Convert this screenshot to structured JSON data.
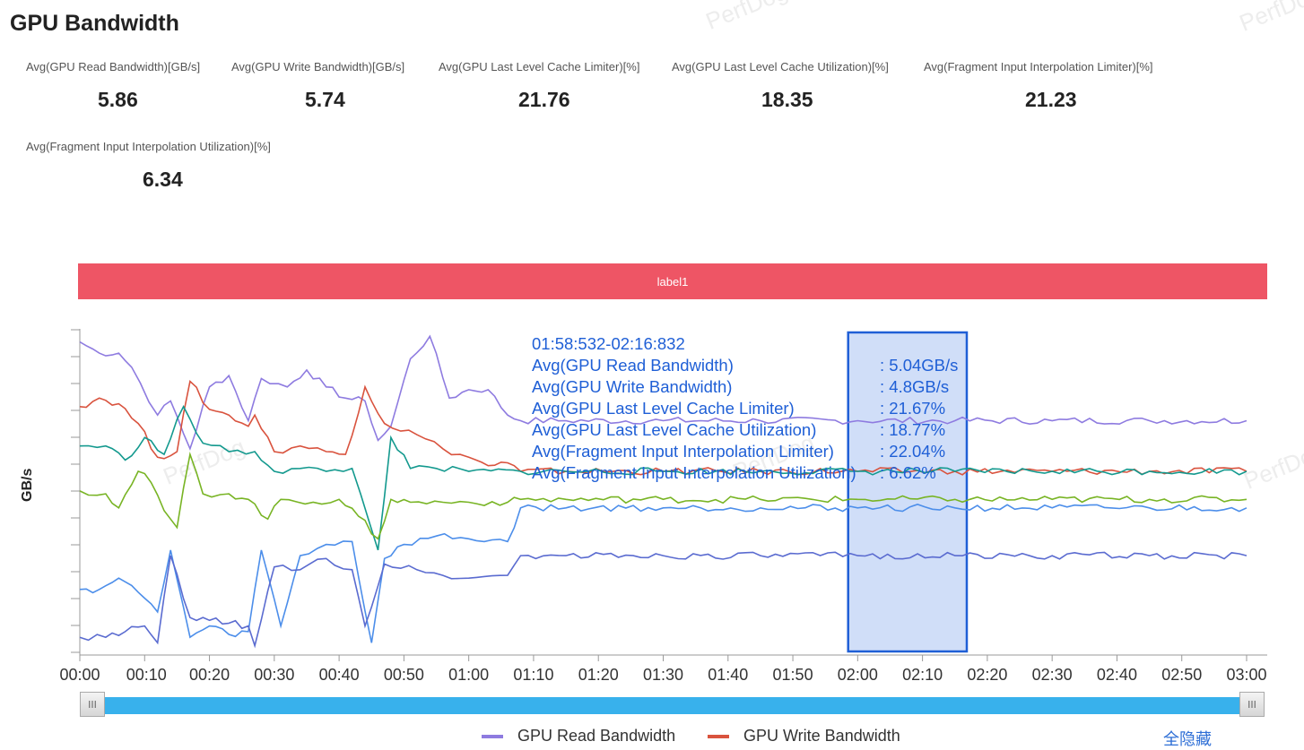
{
  "page": {
    "title": "GPU Bandwidth",
    "watermark": "PerfDog"
  },
  "stats": [
    {
      "label": "Avg(GPU Read Bandwidth)[GB/s]",
      "value": "5.86"
    },
    {
      "label": "Avg(GPU Write Bandwidth)[GB/s]",
      "value": "5.74"
    },
    {
      "label": "Avg(GPU Last Level Cache Limiter)[%]",
      "value": "21.76"
    },
    {
      "label": "Avg(GPU Last Level Cache Utilization)[%]",
      "value": "18.35"
    },
    {
      "label": "Avg(Fragment Input Interpolation Limiter)[%]",
      "value": "21.23"
    },
    {
      "label": "Avg(Fragment Input Interpolation Utilization)[%]",
      "value": "6.34"
    }
  ],
  "label_bar": {
    "text": "label1",
    "color": "#ee5565"
  },
  "tooltip": {
    "range": "01:58:532-02:16:832",
    "rows": [
      {
        "name": "Avg(GPU Read Bandwidth)",
        "value": ": 5.04GB/s"
      },
      {
        "name": "Avg(GPU Write Bandwidth)",
        "value": ": 4.8GB/s"
      },
      {
        "name": "Avg(GPU Last Level Cache Limiter)",
        "value": ": 21.67%"
      },
      {
        "name": "Avg(GPU Last Level Cache Utilization)",
        "value": ": 18.77%"
      },
      {
        "name": "Avg(Fragment Input Interpolation Limiter)",
        "value": ": 22.04%"
      },
      {
        "name": "Avg(Fragment Input Interpolation Utilization)",
        "value": ": 6.62%"
      }
    ]
  },
  "controls": {
    "hide_all": "全隐藏",
    "slider_handle_glyph": "III"
  },
  "chart_data": {
    "type": "line",
    "ylabel": "GB/s",
    "xlabel": "",
    "x_ticks": [
      "00:00",
      "00:10",
      "00:20",
      "00:30",
      "00:40",
      "00:50",
      "01:00",
      "01:10",
      "01:20",
      "01:30",
      "01:40",
      "01:50",
      "02:00",
      "02:10",
      "02:20",
      "02:30",
      "02:40",
      "02:50",
      "03:00"
    ],
    "x_range_seconds": [
      0,
      180
    ],
    "y_ticks_count": 12,
    "selection": {
      "start": "01:58:532",
      "end": "02:16:832"
    },
    "legend_visible": [
      "GPU Read Bandwidth",
      "GPU Write Bandwidth"
    ],
    "series": [
      {
        "name": "GPU Read Bandwidth",
        "color": "#8e7be0",
        "segments": [
          [
            0,
            8.6
          ],
          [
            3,
            8.2
          ],
          [
            6,
            8.2
          ],
          [
            8,
            7.7
          ],
          [
            12,
            6.0
          ],
          [
            14,
            6.5
          ],
          [
            17,
            4.8
          ],
          [
            20,
            7.0
          ],
          [
            23,
            7.4
          ],
          [
            26,
            5.8
          ],
          [
            28,
            7.3
          ],
          [
            32,
            7.0
          ],
          [
            35,
            7.6
          ],
          [
            38,
            7.0
          ],
          [
            41,
            6.6
          ],
          [
            44,
            6.5
          ],
          [
            46,
            5.1
          ],
          [
            48,
            5.6
          ],
          [
            51,
            8.0
          ],
          [
            54,
            8.8
          ],
          [
            57,
            6.6
          ],
          [
            60,
            6.9
          ],
          [
            63,
            6.9
          ],
          [
            66,
            6.0
          ],
          [
            68,
            5.8
          ],
          [
            75,
            5.8
          ],
          [
            90,
            5.8
          ],
          [
            105,
            5.8
          ],
          [
            120,
            5.8
          ],
          [
            135,
            5.8
          ],
          [
            150,
            5.8
          ],
          [
            165,
            5.8
          ],
          [
            180,
            5.8
          ]
        ]
      },
      {
        "name": "GPU Write Bandwidth",
        "color": "#d9533e",
        "segments": [
          [
            0,
            6.3
          ],
          [
            3,
            6.6
          ],
          [
            6,
            6.4
          ],
          [
            9,
            5.7
          ],
          [
            12,
            4.5
          ],
          [
            15,
            4.7
          ],
          [
            17,
            7.2
          ],
          [
            20,
            6.2
          ],
          [
            23,
            6.0
          ],
          [
            26,
            5.6
          ],
          [
            27,
            6.0
          ],
          [
            30,
            4.7
          ],
          [
            34,
            4.9
          ],
          [
            38,
            4.7
          ],
          [
            41,
            4.6
          ],
          [
            44,
            7.0
          ],
          [
            47,
            5.7
          ],
          [
            52,
            5.3
          ],
          [
            56,
            4.8
          ],
          [
            60,
            4.5
          ],
          [
            63,
            4.2
          ],
          [
            66,
            4.3
          ],
          [
            68,
            4.0
          ],
          [
            75,
            4.0
          ],
          [
            90,
            4.0
          ],
          [
            105,
            4.0
          ],
          [
            120,
            4.0
          ],
          [
            135,
            4.0
          ],
          [
            150,
            4.0
          ],
          [
            165,
            4.0
          ],
          [
            180,
            4.0
          ]
        ]
      },
      {
        "name": "GPU Last Level Cache Limiter",
        "color": "#13998e",
        "segments": [
          [
            0,
            4.9
          ],
          [
            4,
            4.9
          ],
          [
            7,
            4.4
          ],
          [
            10,
            5.2
          ],
          [
            13,
            4.6
          ],
          [
            16,
            6.3
          ],
          [
            19,
            5.0
          ],
          [
            23,
            4.7
          ],
          [
            27,
            4.7
          ],
          [
            30,
            4.0
          ],
          [
            34,
            4.1
          ],
          [
            38,
            4.0
          ],
          [
            42,
            4.1
          ],
          [
            46,
            1.2
          ],
          [
            48,
            5.2
          ],
          [
            51,
            4.1
          ],
          [
            55,
            4.1
          ],
          [
            60,
            4.0
          ],
          [
            68,
            4.0
          ],
          [
            75,
            4.0
          ],
          [
            90,
            4.0
          ],
          [
            105,
            4.0
          ],
          [
            120,
            4.0
          ],
          [
            135,
            4.0
          ],
          [
            150,
            4.0
          ],
          [
            165,
            4.0
          ],
          [
            180,
            4.0
          ]
        ]
      },
      {
        "name": "GPU Last Level Cache Utilization",
        "color": "#78b424",
        "segments": [
          [
            0,
            3.3
          ],
          [
            4,
            3.2
          ],
          [
            6,
            2.7
          ],
          [
            9,
            4.0
          ],
          [
            11,
            3.6
          ],
          [
            13,
            2.6
          ],
          [
            15,
            2.0
          ],
          [
            17,
            4.6
          ],
          [
            19,
            3.2
          ],
          [
            23,
            3.2
          ],
          [
            26,
            3.0
          ],
          [
            29,
            2.3
          ],
          [
            31,
            3.0
          ],
          [
            36,
            2.9
          ],
          [
            40,
            3.0
          ],
          [
            43,
            2.4
          ],
          [
            46,
            1.6
          ],
          [
            48,
            3.0
          ],
          [
            51,
            2.9
          ],
          [
            56,
            2.9
          ],
          [
            60,
            2.9
          ],
          [
            66,
            2.9
          ],
          [
            68,
            3.0
          ],
          [
            75,
            3.0
          ],
          [
            90,
            3.0
          ],
          [
            105,
            3.0
          ],
          [
            120,
            3.0
          ],
          [
            135,
            3.0
          ],
          [
            150,
            3.0
          ],
          [
            165,
            3.0
          ],
          [
            180,
            3.0
          ]
        ]
      },
      {
        "name": "Fragment Input Interpolation Limiter",
        "color": "#4c8eea",
        "segments": [
          [
            0,
            -0.2
          ],
          [
            3,
            -0.2
          ],
          [
            6,
            0.2
          ],
          [
            9,
            -0.3
          ],
          [
            12,
            -1.0
          ],
          [
            14,
            1.2
          ],
          [
            17,
            -1.9
          ],
          [
            20,
            -1.5
          ],
          [
            23,
            -1.8
          ],
          [
            26,
            -1.7
          ],
          [
            28,
            1.2
          ],
          [
            31,
            -1.5
          ],
          [
            34,
            1.0
          ],
          [
            38,
            1.4
          ],
          [
            42,
            1.5
          ],
          [
            45,
            -2.1
          ],
          [
            47,
            0.9
          ],
          [
            50,
            1.4
          ],
          [
            55,
            1.7
          ],
          [
            60,
            1.6
          ],
          [
            66,
            1.5
          ],
          [
            68,
            2.7
          ],
          [
            75,
            2.7
          ],
          [
            90,
            2.7
          ],
          [
            105,
            2.7
          ],
          [
            120,
            2.7
          ],
          [
            135,
            2.7
          ],
          [
            150,
            2.7
          ],
          [
            165,
            2.7
          ],
          [
            180,
            2.7
          ]
        ]
      },
      {
        "name": "Fragment Input Interpolation Utilization",
        "color": "#5a6bd0",
        "segments": [
          [
            0,
            -1.9
          ],
          [
            4,
            -1.9
          ],
          [
            7,
            -1.7
          ],
          [
            10,
            -1.5
          ],
          [
            12,
            -2.1
          ],
          [
            14,
            1.0
          ],
          [
            17,
            -1.2
          ],
          [
            20,
            -1.3
          ],
          [
            23,
            -1.4
          ],
          [
            26,
            -1.5
          ],
          [
            27,
            -2.2
          ],
          [
            30,
            0.6
          ],
          [
            34,
            0.5
          ],
          [
            38,
            0.9
          ],
          [
            42,
            0.5
          ],
          [
            44,
            -1.5
          ],
          [
            47,
            0.7
          ],
          [
            52,
            0.5
          ],
          [
            56,
            0.3
          ],
          [
            60,
            0.2
          ],
          [
            66,
            0.3
          ],
          [
            68,
            1.0
          ],
          [
            75,
            1.0
          ],
          [
            90,
            1.0
          ],
          [
            105,
            1.0
          ],
          [
            120,
            1.0
          ],
          [
            135,
            1.0
          ],
          [
            150,
            1.0
          ],
          [
            165,
            1.0
          ],
          [
            180,
            1.0
          ]
        ]
      }
    ]
  }
}
